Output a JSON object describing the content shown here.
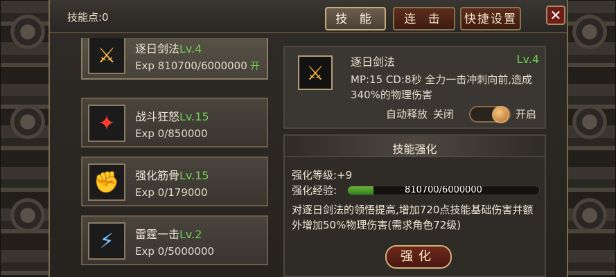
{
  "topbar": {
    "skill_points_label": "技能点:0",
    "tabs": [
      "技 能",
      "连 击",
      "快捷设置"
    ],
    "close_label": "✕"
  },
  "skills": [
    {
      "name": "逐日剑法",
      "level": "Lv.4",
      "exp": "Exp 810700/6000000",
      "flag": "开",
      "icon": "sword-icon"
    },
    {
      "name": "战斗狂怒",
      "level": "Lv.15",
      "exp": "Exp 0/850000",
      "icon": "red-slash-icon"
    },
    {
      "name": "强化筋骨",
      "level": "Lv.15",
      "exp": "Exp 0/179000",
      "icon": "fist-icon"
    },
    {
      "name": "雷霆一击",
      "level": "Lv.2",
      "exp": "Exp 0/5000000",
      "icon": "lightning-icon"
    }
  ],
  "detail": {
    "name": "逐日剑法",
    "level": "Lv.4",
    "desc": "MP:15  CD:8秒  全力一击冲刺向前,造成340%的物理伤害",
    "auto_label": "自动释放",
    "off_label": "关闭",
    "on_label": "开启",
    "toggle_state": "on"
  },
  "enhance": {
    "title": "技能强化",
    "level_label": "强化等级:+9",
    "exp_label": "强化经验:",
    "bar_text": "810700/6000000",
    "progress": 0.135,
    "desc": "对逐日剑法的领悟提高,增加720点技能基础伤害并额外增加50%物理伤害(需求角色72级)",
    "button_label": "强化"
  },
  "colors": {
    "level_green": "#6fcf54",
    "progress_green": "#4aa62d",
    "tab_red": "#5d2d1d",
    "gold_border": "#c7ad7a"
  }
}
